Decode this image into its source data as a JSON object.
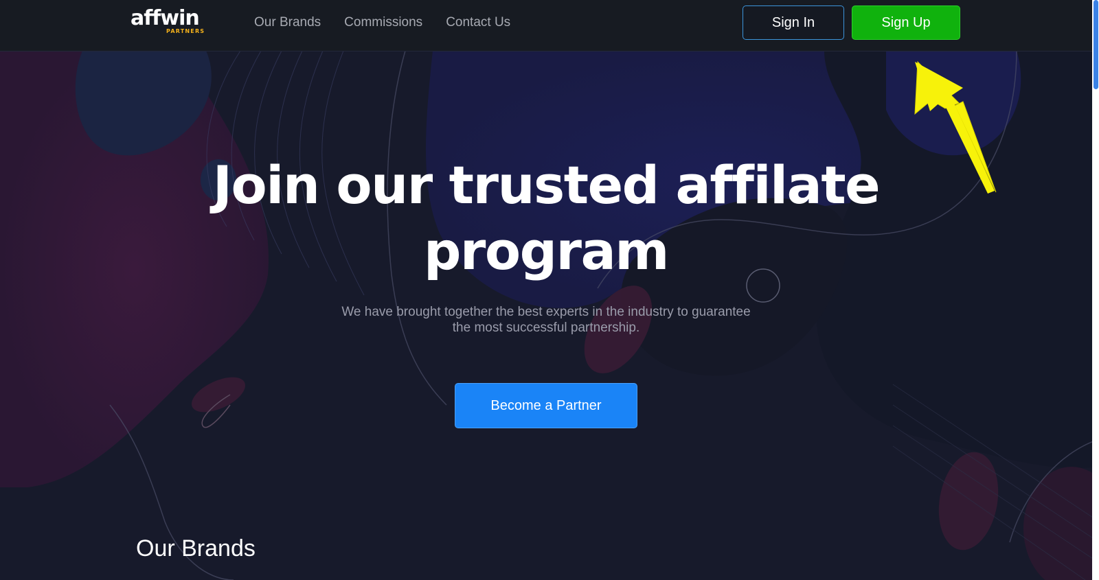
{
  "header": {
    "logo": {
      "main": "affwin",
      "sub": "PARTNERS"
    },
    "nav": [
      {
        "label": "Our Brands"
      },
      {
        "label": "Commissions"
      },
      {
        "label": "Contact Us"
      }
    ],
    "sign_in_label": "Sign In",
    "sign_up_label": "Sign Up"
  },
  "hero": {
    "title_line1": "Join our trusted affilate",
    "title_line2": "program",
    "subtitle_line1": "We have brought together the best experts in the industry to guarantee",
    "subtitle_line2": "the most successful partnership.",
    "cta_label": "Become a Partner"
  },
  "section": {
    "title": "Our Brands"
  },
  "colors": {
    "header_bg": "#171b22",
    "sign_up_green": "#10b20d",
    "sign_in_border": "#3c95dc",
    "cta_blue": "#1a84f7",
    "logo_accent": "#f5b21b",
    "annotation_arrow": "#f7f20a"
  },
  "icons": {
    "annotation": "yellow-arrow-icon",
    "logo_mark": "crown-icon"
  }
}
